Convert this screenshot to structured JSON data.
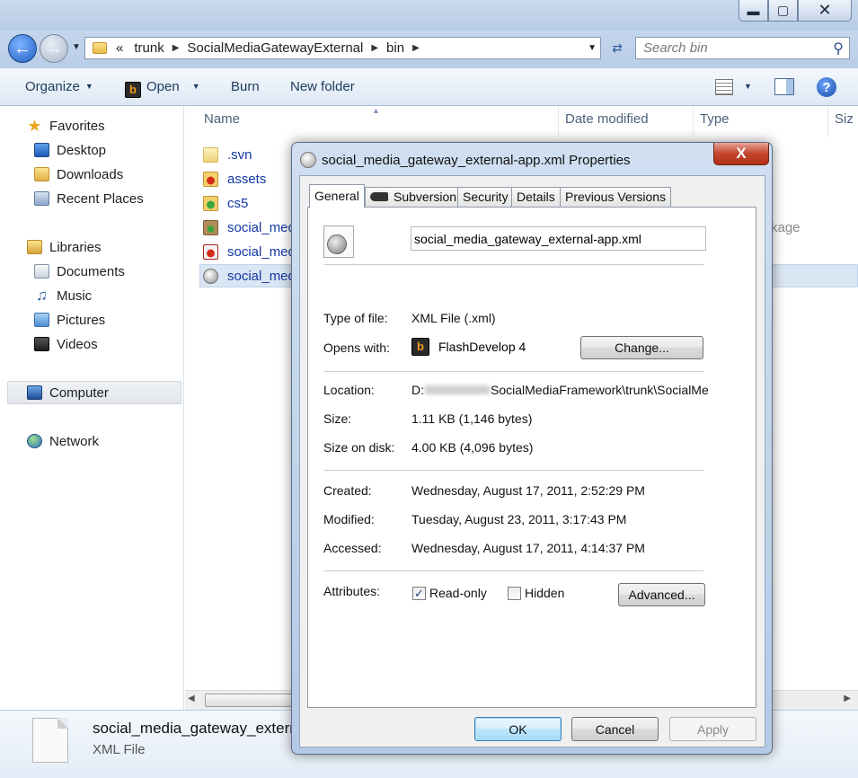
{
  "window": {
    "caption_buttons": {
      "minimize": "▬",
      "maximize": "▢",
      "close": "✕"
    }
  },
  "address": {
    "overflow": "«",
    "crumbs": [
      "trunk",
      "SocialMediaGatewayExternal",
      "bin"
    ],
    "search_placeholder": "Search bin"
  },
  "toolbar": {
    "organize": "Organize",
    "open": "Open",
    "burn": "Burn",
    "new_folder": "New folder"
  },
  "nav": {
    "favorites": "Favorites",
    "desktop": "Desktop",
    "downloads": "Downloads",
    "recent_places": "Recent Places",
    "libraries": "Libraries",
    "documents": "Documents",
    "music": "Music",
    "pictures": "Pictures",
    "videos": "Videos",
    "computer": "Computer",
    "network": "Network"
  },
  "filelist": {
    "columns": [
      "Name",
      "Date modified",
      "Type",
      "Siz"
    ],
    "rows": [
      ".svn",
      "assets",
      "cs5",
      "social_medi",
      "social_medi",
      "social_medi"
    ],
    "partial_type_text": "kage"
  },
  "details_pane": {
    "filename": "social_media_gateway_extern",
    "filetype": "XML File"
  },
  "dialog": {
    "title": "social_media_gateway_external-app.xml Properties",
    "close": "X",
    "tabs": [
      "General",
      "Subversion",
      "Security",
      "Details",
      "Previous Versions"
    ],
    "filename": "social_media_gateway_external-app.xml",
    "type_label": "Type of file:",
    "type_value": "XML File (.xml)",
    "opens_label": "Opens with:",
    "opens_value": "FlashDevelop 4",
    "change_button": "Change...",
    "location_label": "Location:",
    "location_prefix": "D:",
    "location_suffix": "SocialMediaFramework\\trunk\\SocialMedia",
    "size_label": "Size:",
    "size_value": "1.11 KB (1,146 bytes)",
    "size_disk_label": "Size on disk:",
    "size_disk_value": "4.00 KB (4,096 bytes)",
    "created_label": "Created:",
    "created_value": "Wednesday, August 17, 2011, 2:52:29 PM",
    "modified_label": "Modified:",
    "modified_value": "Tuesday, August 23, 2011, 3:17:43 PM",
    "accessed_label": "Accessed:",
    "accessed_value": "Wednesday, August 17, 2011, 4:14:37 PM",
    "attributes_label": "Attributes:",
    "readonly_label": "Read-only",
    "readonly_checked": true,
    "hidden_label": "Hidden",
    "hidden_checked": false,
    "advanced_button": "Advanced...",
    "ok_button": "OK",
    "cancel_button": "Cancel",
    "apply_button": "Apply"
  },
  "colors": {
    "accent": "#1238a7",
    "chrome": "#b9cde7",
    "selection": "#dbe6f4",
    "dialog_close": "#c2452d"
  }
}
